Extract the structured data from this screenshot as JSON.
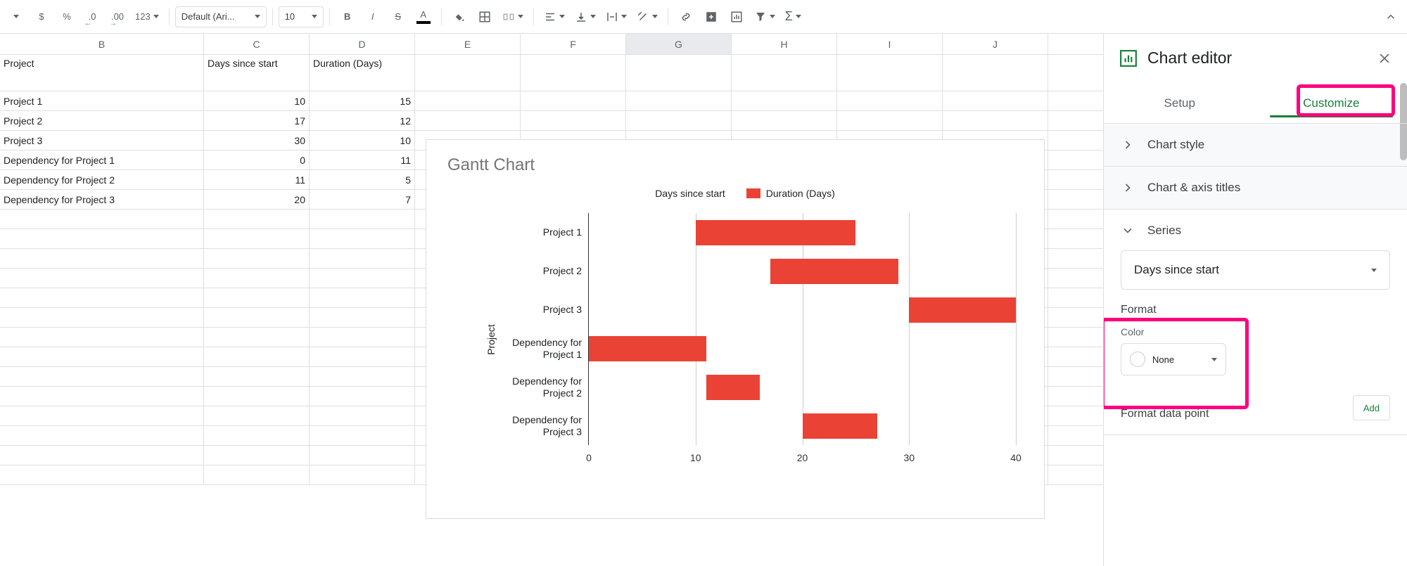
{
  "toolbar": {
    "currency_label": "$",
    "percent_label": "%",
    "dec_dec_label": ".0",
    "inc_dec_label": ".00",
    "more_formats_label": "123",
    "font_name": "Default (Ari...",
    "font_size": "10"
  },
  "columns": [
    "B",
    "C",
    "D",
    "E",
    "F",
    "G",
    "H",
    "I",
    "J"
  ],
  "selected_col": "G",
  "table": {
    "headers": {
      "b": "Project",
      "c": "Days since start",
      "d": "Duration (Days)"
    },
    "rows": [
      {
        "b": "Project 1",
        "c": "10",
        "d": "15"
      },
      {
        "b": "Project 2",
        "c": "17",
        "d": "12"
      },
      {
        "b": "Project 3",
        "c": "30",
        "d": "10"
      },
      {
        "b": "Dependency for Project 1",
        "c": "0",
        "d": "11"
      },
      {
        "b": "Dependency for Project 2",
        "c": "11",
        "d": "5"
      },
      {
        "b": "Dependency for Project 3",
        "c": "20",
        "d": "7"
      }
    ]
  },
  "chart_data": {
    "type": "bar",
    "title": "Gantt Chart",
    "ylabel": "Project",
    "xlabel": "",
    "xlim": [
      0,
      40
    ],
    "x_ticks": [
      0,
      10,
      20,
      30,
      40
    ],
    "categories": [
      "Project 1",
      "Project 2",
      "Project 3",
      "Dependency for Project 1",
      "Dependency for Project 2",
      "Dependency for Project 3"
    ],
    "series": [
      {
        "name": "Days since start",
        "values": [
          10,
          17,
          30,
          0,
          11,
          20
        ],
        "color": "none"
      },
      {
        "name": "Duration (Days)",
        "values": [
          15,
          12,
          10,
          11,
          5,
          7
        ],
        "color": "#ea4335"
      }
    ]
  },
  "chart_legend": [
    {
      "name": "Days since start",
      "color": "#ffffff"
    },
    {
      "name": "Duration (Days)",
      "color": "#ea4335"
    }
  ],
  "chart_bar_labels": [
    "Project 1",
    "Project 2",
    "Project 3",
    "Dependency for\nProject 1",
    "Dependency for\nProject 2",
    "Dependency for\nProject 3"
  ],
  "panel": {
    "title": "Chart editor",
    "tabs": {
      "setup": "Setup",
      "customize": "Customize"
    },
    "sections": {
      "chart_style": "Chart style",
      "axis_titles": "Chart & axis titles",
      "series": "Series",
      "format": "Format",
      "color_label": "Color",
      "color_value": "None",
      "format_dp": "Format data point",
      "add": "Add"
    },
    "series_selected": "Days since start"
  }
}
